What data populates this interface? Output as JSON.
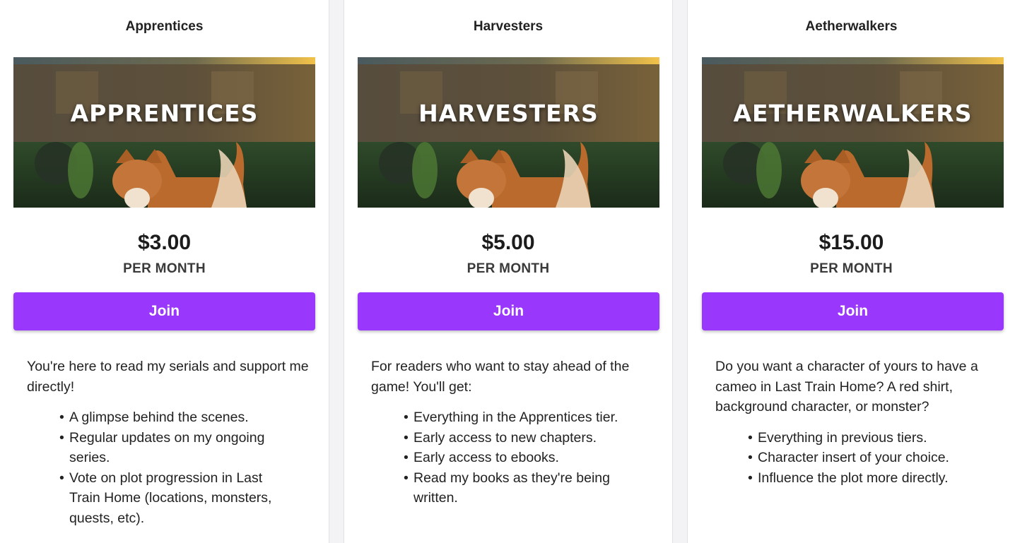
{
  "tiers": [
    {
      "name": "Apprentices",
      "banner_text": "APPRENTICES",
      "price": "$3.00",
      "per": "PER MONTH",
      "join_label": "Join",
      "description": "You're here to read my serials and support me directly!",
      "perks": [
        "A glimpse behind the scenes.",
        "Regular updates on my ongoing series.",
        "Vote on plot progression in Last Train Home (locations, monsters, quests, etc)."
      ]
    },
    {
      "name": "Harvesters",
      "banner_text": "HARVESTERS",
      "price": "$5.00",
      "per": "PER MONTH",
      "join_label": "Join",
      "description": "For readers who want to stay ahead of the game! You'll get:",
      "perks": [
        "Everything in the Apprentices tier.",
        "Early access to new chapters.",
        "Early access to ebooks.",
        "Read my books as they're being written."
      ]
    },
    {
      "name": "Aetherwalkers",
      "banner_text": "AETHERWALKERS",
      "price": "$15.00",
      "per": "PER MONTH",
      "join_label": "Join",
      "description": "Do you want a character of yours to have a cameo in Last Train Home? A red shirt, background character, or monster?",
      "perks": [
        "Everything in previous tiers.",
        "Character insert of your choice.",
        "Influence the plot more directly."
      ]
    }
  ],
  "colors": {
    "join_button": "#9937fc",
    "card_background": "#ffffff",
    "page_background": "#f3f3f5"
  }
}
